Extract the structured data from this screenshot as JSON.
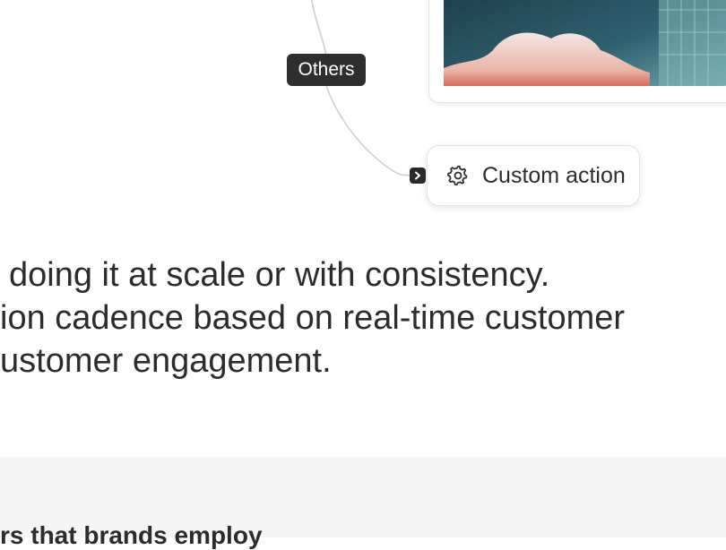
{
  "diagram": {
    "branch_label": "Others",
    "action_node": {
      "label": "Custom action",
      "icon": "gear-icon"
    },
    "badge_icon": "chevron-right-icon",
    "image_card_icon": "image-thumbnail"
  },
  "body": {
    "lines": [
      "doing it at scale or with consistency.",
      "ion cadence based on real-time customer",
      "ustomer engagement."
    ]
  },
  "section": {
    "heading": "rs that brands employ"
  },
  "colors": {
    "label_bg": "#2e2e2e",
    "text": "#2c2c2c",
    "section_bg": "#f5f5f5",
    "connector": "#cfcfcf"
  }
}
